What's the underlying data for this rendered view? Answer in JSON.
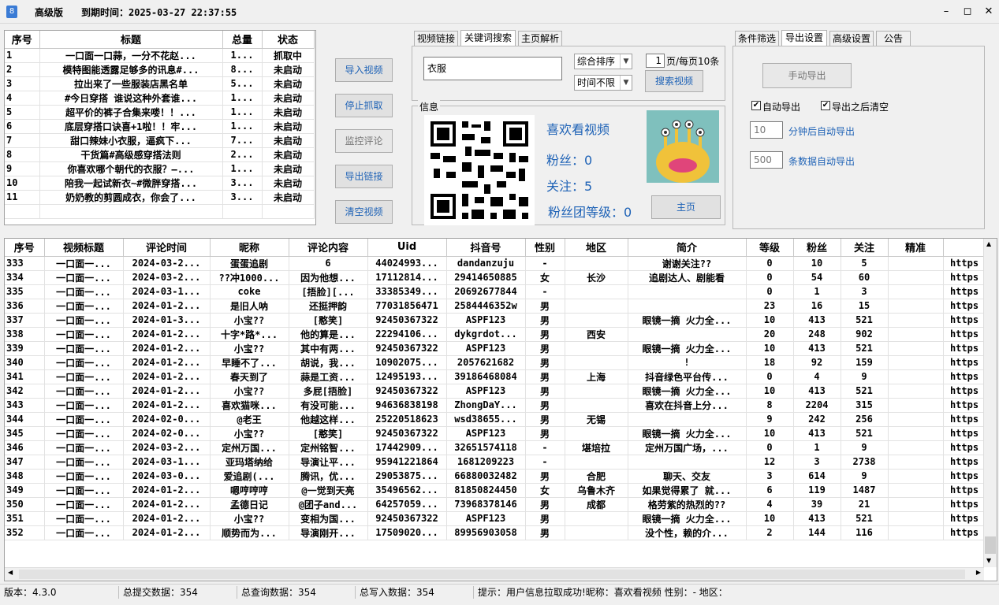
{
  "titlebar": {
    "edition": "高级版",
    "expire": "到期时间：2025-03-27 22:37:55"
  },
  "task_table": {
    "columns": [
      "序号",
      "标题",
      "总量",
      "状态"
    ],
    "rows": [
      [
        "1",
        "一口面一口蒜，一分不花赵...",
        "1...",
        "抓取中"
      ],
      [
        "2",
        "模特图能透露足够多的讯息#...",
        "8...",
        "未启动"
      ],
      [
        "3",
        "拉出来了一些服装店黑名单",
        "5...",
        "未启动"
      ],
      [
        "4",
        "#今日穿搭 谁说这种外套谁...",
        "1...",
        "未启动"
      ],
      [
        "5",
        "超平价的裤子合集来喽！！...",
        "1...",
        "未启动"
      ],
      [
        "6",
        "底层穿搭口诀喜+1啦！！牢...",
        "1...",
        "未启动"
      ],
      [
        "7",
        "甜口辣妹小衣服，逼疯下...",
        "7...",
        "未启动"
      ],
      [
        "8",
        "干货篇#高级感穿搭法则",
        "2...",
        "未启动"
      ],
      [
        "9",
        "你喜欢哪个朝代的衣服？—...",
        "1...",
        "未启动"
      ],
      [
        "10",
        "陪我一起试新衣~#微胖穿搭...",
        "3...",
        "未启动"
      ],
      [
        "11",
        "奶奶教的剪圆成衣，你会了...",
        "3...",
        "未启动"
      ]
    ]
  },
  "actions": {
    "import": "导入视频",
    "stop": "停止抓取",
    "monitor": "监控评论",
    "export_links": "导出链接",
    "clear": "清空视频"
  },
  "search_tabs": [
    "视频链接",
    "关键词搜索",
    "主页解析"
  ],
  "search": {
    "keyword": "衣服",
    "sort": "综合排序",
    "time": "时间不限",
    "page": "1",
    "page_suffix": "页/每页10条",
    "search_button": "搜索视频"
  },
  "info": {
    "legend": "信息",
    "name": "喜欢看视频",
    "fans": "粉丝：0",
    "follow": "关注：5",
    "fan_level": "粉丝团等级：0",
    "home_button": "主页"
  },
  "right_tabs": [
    "条件筛选",
    "导出设置",
    "高级设置",
    "公告"
  ],
  "export": {
    "manual_button": "手动导出",
    "auto_export": "自动导出",
    "clear_after": "导出之后清空",
    "minutes_value": "10",
    "minutes_label": "分钟后自动导出",
    "count_value": "500",
    "count_label": "条数据自动导出"
  },
  "comments": {
    "columns": [
      "序号",
      "视频标题",
      "评论时间",
      "昵称",
      "评论内容",
      "Uid",
      "抖音号",
      "性别",
      "地区",
      "简介",
      "等级",
      "粉丝",
      "关注",
      "精准",
      ""
    ],
    "rows": [
      [
        "333",
        "一口面一...",
        "2024-03-2...",
        "蛋蛋追剧",
        "6",
        "44024993...",
        "dandanzuju",
        "-",
        "",
        "谢谢关注??",
        "0",
        "10",
        "5",
        "",
        "https"
      ],
      [
        "334",
        "一口面一...",
        "2024-03-2...",
        "??冲1000...",
        "因为他想...",
        "17112814...",
        "29414650885",
        "女",
        "长沙",
        "追剧达人、剧能看",
        "0",
        "54",
        "60",
        "",
        "https"
      ],
      [
        "335",
        "一口面一...",
        "2024-03-1...",
        "coke",
        "[捂脸][...",
        "33385349...",
        "20692677844",
        "-",
        "",
        "",
        "0",
        "1",
        "3",
        "",
        "https"
      ],
      [
        "336",
        "一口面一...",
        "2024-01-2...",
        "是旧人呐",
        "还挺押韵",
        "77031856471",
        "2584446352w",
        "男",
        "",
        "",
        "23",
        "16",
        "15",
        "",
        "https"
      ],
      [
        "337",
        "一口面一...",
        "2024-01-3...",
        "小宝??",
        "[憨笑]",
        "92450367322",
        "ASPF123",
        "男",
        "",
        "眼镜一摘 火力全...",
        "10",
        "413",
        "521",
        "",
        "https"
      ],
      [
        "338",
        "一口面一...",
        "2024-01-2...",
        "十字*路*...",
        "他的算是...",
        "22294106...",
        "dykgrdot...",
        "男",
        "西安",
        "",
        "20",
        "248",
        "902",
        "",
        "https"
      ],
      [
        "339",
        "一口面一...",
        "2024-01-2...",
        "小宝??",
        "其中有两...",
        "92450367322",
        "ASPF123",
        "男",
        "",
        "眼镜一摘 火力全...",
        "10",
        "413",
        "521",
        "",
        "https"
      ],
      [
        "340",
        "一口面一...",
        "2024-01-2...",
        "早睡不了...",
        "胡说，我...",
        "10902075...",
        "2057621682",
        "男",
        "",
        "!",
        "18",
        "92",
        "159",
        "",
        "https"
      ],
      [
        "341",
        "一口面一...",
        "2024-01-2...",
        "春天到了",
        "蒜是工资...",
        "12495193...",
        "39186468084",
        "男",
        "上海",
        "抖音绿色平台传...",
        "0",
        "4",
        "9",
        "",
        "https"
      ],
      [
        "342",
        "一口面一...",
        "2024-01-2...",
        "小宝??",
        "多屁[捂脸]",
        "92450367322",
        "ASPF123",
        "男",
        "",
        "眼镜一摘 火力全...",
        "10",
        "413",
        "521",
        "",
        "https"
      ],
      [
        "343",
        "一口面一...",
        "2024-01-2...",
        "喜欢猫咪...",
        "有没可能...",
        "94636838198",
        "ZhongDaY...",
        "男",
        "",
        "喜欢在抖音上分...",
        "8",
        "2204",
        "315",
        "",
        "https"
      ],
      [
        "344",
        "一口面一...",
        "2024-02-0...",
        "@老王",
        "他越这样...",
        "25220518623",
        "wsd38655...",
        "男",
        "无锡",
        "",
        "9",
        "242",
        "256",
        "",
        "https"
      ],
      [
        "345",
        "一口面一...",
        "2024-02-0...",
        "小宝??",
        "[憨笑]",
        "92450367322",
        "ASPF123",
        "男",
        "",
        "眼镜一摘 火力全...",
        "10",
        "413",
        "521",
        "",
        "https"
      ],
      [
        "346",
        "一口面一...",
        "2024-03-2...",
        "定州万国...",
        "定州铭智...",
        "17442909...",
        "32651574118",
        "-",
        "堪培拉",
        "定州万国广场，...",
        "0",
        "1",
        "9",
        "",
        "https"
      ],
      [
        "347",
        "一口面一...",
        "2024-03-1...",
        "亚玛塔纳给",
        "导演让平...",
        "95941221864",
        "1681209223",
        "-",
        "",
        "",
        "12",
        "3",
        "2738",
        "",
        "https"
      ],
      [
        "348",
        "一口面一...",
        "2024-03-0...",
        "爱追剧(...",
        "腾讯，优...",
        "29053875...",
        "66880032482",
        "男",
        "合肥",
        "聊天、交友",
        "3",
        "614",
        "9",
        "",
        "https"
      ],
      [
        "349",
        "一口面一...",
        "2024-01-2...",
        "嗯哼哼哼",
        "@一觉到天亮",
        "35496562...",
        "81850824450",
        "女",
        "乌鲁木齐",
        "如果觉得累了 就...",
        "6",
        "119",
        "1487",
        "",
        "https"
      ],
      [
        "350",
        "一口面一...",
        "2024-01-2...",
        "孟德日记",
        "@团子and...",
        "64257059...",
        "73968378146",
        "男",
        "成都",
        "格劳紫的热烈的??",
        "4",
        "39",
        "21",
        "",
        "https"
      ],
      [
        "351",
        "一口面一...",
        "2024-01-2...",
        "小宝??",
        "变相为国...",
        "92450367322",
        "ASPF123",
        "男",
        "",
        "眼镜一摘 火力全...",
        "10",
        "413",
        "521",
        "",
        "https"
      ],
      [
        "352",
        "一口面一...",
        "2024-01-2...",
        "顺势而为...",
        "导演刚开...",
        "17509020...",
        "89956903058",
        "男",
        "",
        "没个性，赖的介...",
        "2",
        "144",
        "116",
        "",
        "https"
      ]
    ]
  },
  "status": {
    "version": "版本：4.3.0",
    "submitted": "总提交数据：354",
    "queried": "总查询数据：354",
    "written": "总写入数据：354",
    "tip": "提示：用户信息拉取成功!昵称：喜欢看视频 性别：- 地区："
  }
}
